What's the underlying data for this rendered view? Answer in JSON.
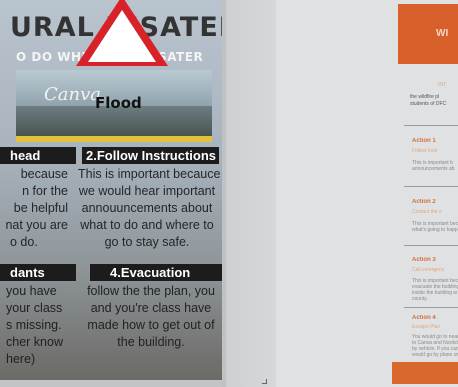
{
  "poster": {
    "title": "URAL DISATERS",
    "subtitle": "O DO WHILE IN A DISATER",
    "hero": {
      "brand_text": "Canva",
      "sign_label": "Flood"
    },
    "sections": [
      {
        "heading": "head",
        "lines": [
          "because",
          "n for the",
          "be helpful",
          "nat you are",
          "o do."
        ]
      },
      {
        "heading": "2.Follow Instructions",
        "lines": [
          "This is important becauce",
          "we would hear important",
          "annouuncements about",
          "what to do and where to",
          "go to stay safe."
        ]
      },
      {
        "heading": "dants",
        "lines": [
          "you have",
          "your class",
          "s missing.",
          "cher know",
          "here)"
        ]
      },
      {
        "heading": "4.Evacuation",
        "lines": [
          "follow the the plan, you",
          "and you're class have",
          "made how to get out of",
          "the building."
        ]
      }
    ]
  },
  "document": {
    "banner_text": "WI",
    "intro_label": "INT",
    "intro_lines": [
      "the wildfire pl",
      "students of DFC"
    ],
    "actions": [
      {
        "title": "Action 1",
        "subtitle": "Follow Instr",
        "lines": [
          "This is important b",
          "announcements ab"
        ]
      },
      {
        "title": "Action 2",
        "subtitle": "Contact the e",
        "lines": [
          "This is important bec",
          "what's going to happ"
        ]
      },
      {
        "title": "Action 3",
        "subtitle": "Call emergenc",
        "lines": [
          "This is important beca",
          "evacuate the building",
          "inside the building w",
          "county."
        ]
      },
      {
        "title": "Action 4",
        "subtitle": "Escape Plan",
        "lines": [
          "You would go to near b",
          "to Canva and Nordstr",
          "by vehicle. If you can't",
          "would go by plane or"
        ]
      }
    ]
  },
  "colors": {
    "accent_orange": "#d8602a",
    "sign_red": "#d8222a",
    "band_yellow": "#e3c23b",
    "header_dark": "#1c1c1c"
  }
}
